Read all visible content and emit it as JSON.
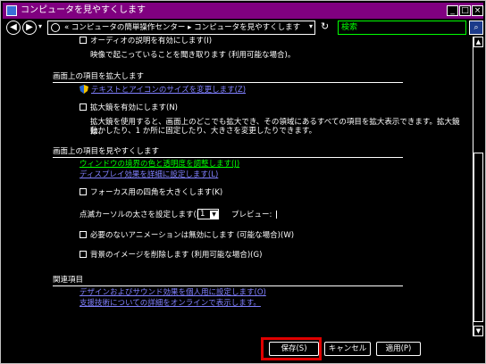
{
  "window": {
    "title": "コンピュータを見やすくします",
    "controls": {
      "minimize": "_",
      "maximize": "□",
      "close": "×"
    }
  },
  "address_bar": {
    "path": "« コンピュータの簡単操作センター ▸ コンピュータを見やすくします",
    "search_placeholder": "検索"
  },
  "content": {
    "top_checkbox_label": "オーディオの説明を有効にします(I)",
    "top_description": "映像で起こっていることを聞き取ります (利用可能な場合)。",
    "section_enlarge": {
      "header": "画面上の項目を拡大します",
      "link_text_size": "テキストとアイコンのサイズを変更します(Z)",
      "magnifier_label": "拡大鏡を有効にします(N)",
      "magnifier_desc_1": "拡大鏡を使用すると、画面上のどこでも拡大でき、その領域にあるすべての項目を拡大表示できます。拡大鏡は、",
      "magnifier_desc_2": "動かしたり、1 か所に固定したり、大きさを変更したりできます。"
    },
    "section_visibility": {
      "header": "画面上の項目を見やすくします",
      "link_window_color": "ウィンドウの境界の色と透明度を調整します(J)",
      "link_display_effects": "ディスプレイ効果を詳細に設定します(L)",
      "focus_rect_label": "フォーカス用の四角を大きくします(K)",
      "cursor_width_label": "点滅カーソルの太さを設定します(B):",
      "cursor_width_value": "1",
      "preview_label": "プレビュー:",
      "animations_label": "必要のないアニメーションは無効にします (可能な場合)(W)",
      "background_label": "背景のイメージを削除します (利用可能な場合)(G)"
    },
    "section_related": {
      "header": "関連項目",
      "link_design_sound": "デザインおよびサウンド効果を個人用に設定します(O)",
      "link_support": "支援技術についての詳細をオンラインで表示します。"
    }
  },
  "buttons": {
    "save": "保存(S)",
    "cancel": "キャンセル",
    "apply": "適用(P)"
  },
  "colors": {
    "title_bar": "#800080",
    "link_green": "#00ff00",
    "link_blue": "#8080ff",
    "highlight": "#e00000"
  }
}
